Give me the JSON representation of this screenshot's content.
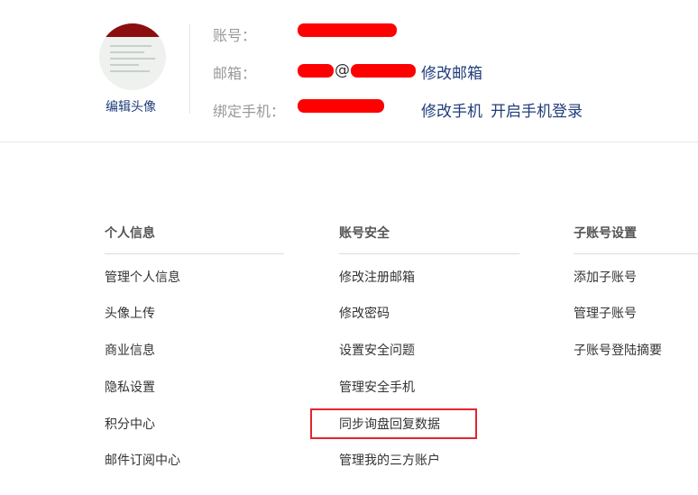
{
  "profile": {
    "edit_avatar_label": "编辑头像",
    "account_label": "账号：",
    "email_label": "邮箱：",
    "email_visible_part": "@",
    "change_email_link": "修改邮箱",
    "phone_label": "绑定手机：",
    "change_phone_link": "修改手机",
    "enable_phone_login_link": "开启手机登录",
    "redaction_color": "#ff0000"
  },
  "sections": {
    "personal": {
      "title": "个人信息",
      "items": [
        "管理个人信息",
        "头像上传",
        "商业信息",
        "隐私设置",
        "积分中心",
        "邮件订阅中心"
      ]
    },
    "security": {
      "title": "账号安全",
      "items": [
        "修改注册邮箱",
        "修改密码",
        "设置安全问题",
        "管理安全手机",
        "同步询盘回复数据",
        "管理我的三方账户"
      ]
    },
    "subaccount": {
      "title": "子账号设置",
      "items": [
        "添加子账号",
        "管理子账号",
        "子账号登陆摘要"
      ]
    }
  },
  "colors": {
    "link": "#1f3d7a",
    "highlight": "#e3262e"
  }
}
